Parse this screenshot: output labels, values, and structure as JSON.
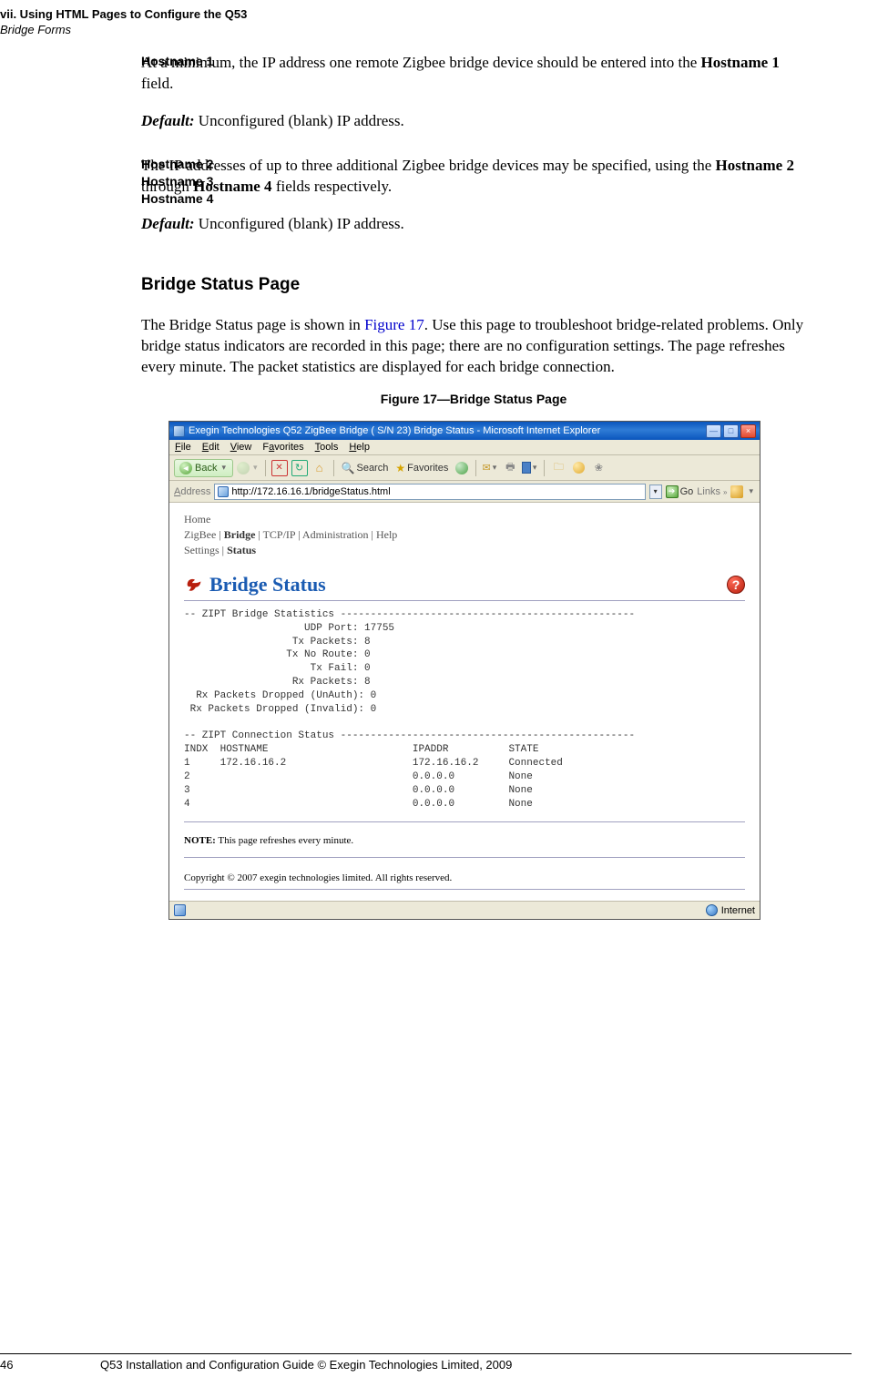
{
  "header": {
    "chapter": "vii. Using HTML Pages to Configure the Q53",
    "section": "Bridge Forms"
  },
  "host1": {
    "label": "Hostname 1",
    "para_prefix": "At a minimum, the IP address one remote Zigbee bridge device should be entered into the ",
    "bold1": "Hostname 1",
    "para_suffix": " field.",
    "default_label": "Default:",
    "default_text": " Unconfigured (blank) IP address."
  },
  "host234": {
    "label1": "Hostname 2",
    "label2": "Hostname 3",
    "label3": "Hostname 4",
    "para_prefix": "The IP addresses of up to three additional Zigbee bridge devices may be specified, using the ",
    "bold1": "Hostname 2",
    "para_mid": " through ",
    "bold2": "Hostname 4",
    "para_suffix": " fields respectively.",
    "default_label": "Default:",
    "default_text": " Unconfigured (blank) IP address."
  },
  "sectionHeading": "Bridge Status Page",
  "bridgePara": {
    "part1": "The Bridge Status page is shown in ",
    "link": "Figure 17",
    "part2": ". Use this page to troubleshoot bridge-related problems. Only bridge status indicators are recorded in this page; there are no configuration settings. The page refreshes every minute. The packet statistics are displayed for each bridge connection."
  },
  "figureCaption": "Figure 17—Bridge Status Page",
  "browser": {
    "titlebar": "Exegin Technologies Q52 ZigBee Bridge ( S/N 23) Bridge Status - Microsoft Internet Explorer",
    "menus": {
      "file": "File",
      "edit": "Edit",
      "view": "View",
      "favorites": "Favorites",
      "tools": "Tools",
      "help": "Help"
    },
    "toolbar": {
      "back": "Back",
      "search": "Search",
      "favorites": "Favorites"
    },
    "addressLabel": "Address",
    "url": "http://172.16.16.1/bridgeStatus.html",
    "go": "Go",
    "links": "Links",
    "nav": {
      "home": "Home",
      "line2_a": "ZigBee | ",
      "line2_bold": "Bridge",
      "line2_b": " | TCP/IP | Administration | Help",
      "line3_a": "Settings | ",
      "line3_bold": "Status"
    },
    "pageTitle": "Bridge Status",
    "pre": "-- ZIPT Bridge Statistics -------------------------------------------------\n                    UDP Port: 17755\n                  Tx Packets: 8\n                 Tx No Route: 0\n                     Tx Fail: 0\n                  Rx Packets: 8\n  Rx Packets Dropped (UnAuth): 0\n Rx Packets Dropped (Invalid): 0\n\n-- ZIPT Connection Status -------------------------------------------------\nINDX  HOSTNAME                        IPADDR          STATE\n1     172.16.16.2                     172.16.16.2     Connected\n2                                     0.0.0.0         None\n3                                     0.0.0.0         None\n4                                     0.0.0.0         None",
    "note_label": "NOTE:",
    "note_text": " This page refreshes every minute.",
    "copyright": "Copyright © 2007 exegin technologies limited. All rights reserved.",
    "status_internet": "Internet"
  },
  "footer": {
    "page": "46",
    "text": "Q53 Installation and Configuration Guide  © Exegin Technologies Limited, 2009"
  }
}
